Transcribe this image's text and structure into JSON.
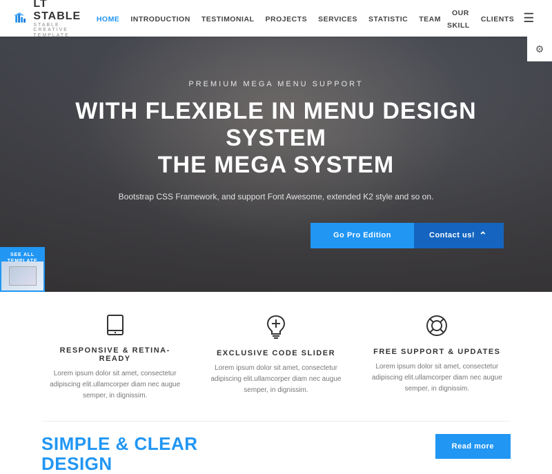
{
  "logo": {
    "title": "LT STABLE",
    "subtitle": "STABLE CREATIVE TEMPLATE"
  },
  "nav": {
    "links": [
      {
        "label": "HOME",
        "active": true
      },
      {
        "label": "INTRODUCTION",
        "active": false
      },
      {
        "label": "TESTIMONIAL",
        "active": false
      },
      {
        "label": "PROJECTS",
        "active": false
      },
      {
        "label": "SERVICES",
        "active": false
      },
      {
        "label": "STATISTIC",
        "active": false
      },
      {
        "label": "TEAM",
        "active": false
      },
      {
        "label": "OUR SKILL",
        "active": false
      },
      {
        "label": "CLIENTS",
        "active": false
      }
    ]
  },
  "hero": {
    "subtitle": "PREMIUM MEGA MENU SUPPORT",
    "title_line1": "WITH FLEXIBLE IN MENU DESIGN SYSTEM",
    "title_line2": "THE MEGA SYSTEM",
    "description": "Bootstrap CSS Framework, and support Font Awesome, extended K2 style and so on.",
    "btn_primary": "Go Pro Edition",
    "btn_secondary": "Contact us!",
    "see_all_label": "SEE ALL TEMPLATE"
  },
  "features": [
    {
      "icon": "tablet",
      "title": "RESPONSIVE & RETINA-READY",
      "desc": "Lorem ipsum dolor sit amet, consectetur adipiscing elit.ullamcorper diam nec augue semper, in dignissim."
    },
    {
      "icon": "bulb",
      "title": "EXCLUSIVE CODE SLIDER",
      "desc": "Lorem ipsum dolor sit amet, consectetur adipiscing elit.ullamcorper diam nec augue semper, in dignissim."
    },
    {
      "icon": "lifering",
      "title": "FREE SUPPORT & UPDATES",
      "desc": "Lorem ipsum dolor sit amet, consectetur adipiscing elit.ullamcorper diam nec augue semper, in dignissim."
    }
  ],
  "bottom": {
    "heading_line1": "SIMPLE & CLEAR",
    "heading_line2": "DESIGN",
    "btn_label": "Read more"
  }
}
